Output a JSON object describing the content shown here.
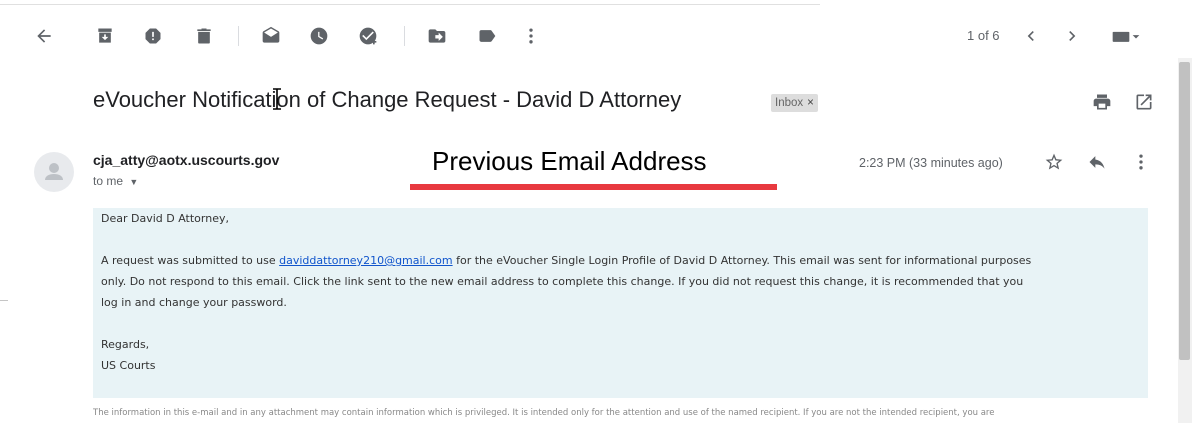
{
  "toolbar": {
    "pager_text": "1 of 6",
    "icons": [
      "back-arrow-icon",
      "archive-icon",
      "report-spam-icon",
      "delete-icon",
      "mark-unread-icon",
      "snooze-icon",
      "add-task-icon",
      "move-to-icon",
      "label-icon",
      "more-vert-icon",
      "prev-icon",
      "next-icon",
      "keyboard-icon"
    ]
  },
  "email": {
    "subject": "eVoucher Notification of Change Request - David D Attorney",
    "label": "Inbox",
    "label_close": "×",
    "sender": "cja_atty@aotx.uscourts.gov",
    "to": "to me",
    "time": "2:23 PM (33 minutes ago)",
    "greeting": "Dear David D Attorney,",
    "para_prefix": "A request was submitted to use ",
    "link_email": "daviddattorney210@gmail.com",
    "para_line1_suffix": " for the eVoucher Single Login Profile of David D Attorney. This email was sent for informational purposes",
    "para_line2": "only. Do not respond to this email. Click the link sent to the new email address to complete this change. If you did not request this change, it is recommended that you",
    "para_line3": "log in and change your password.",
    "regards": "Regards,",
    "signature": "US Courts",
    "disclaimer": "The information in this e-mail and in any attachment may contain information which is privileged. It is intended only for the attention and use of the named recipient. If you are not the intended recipient, you are"
  },
  "annotation": {
    "text": "Previous Email Address",
    "underline_color": "#e8393f"
  }
}
